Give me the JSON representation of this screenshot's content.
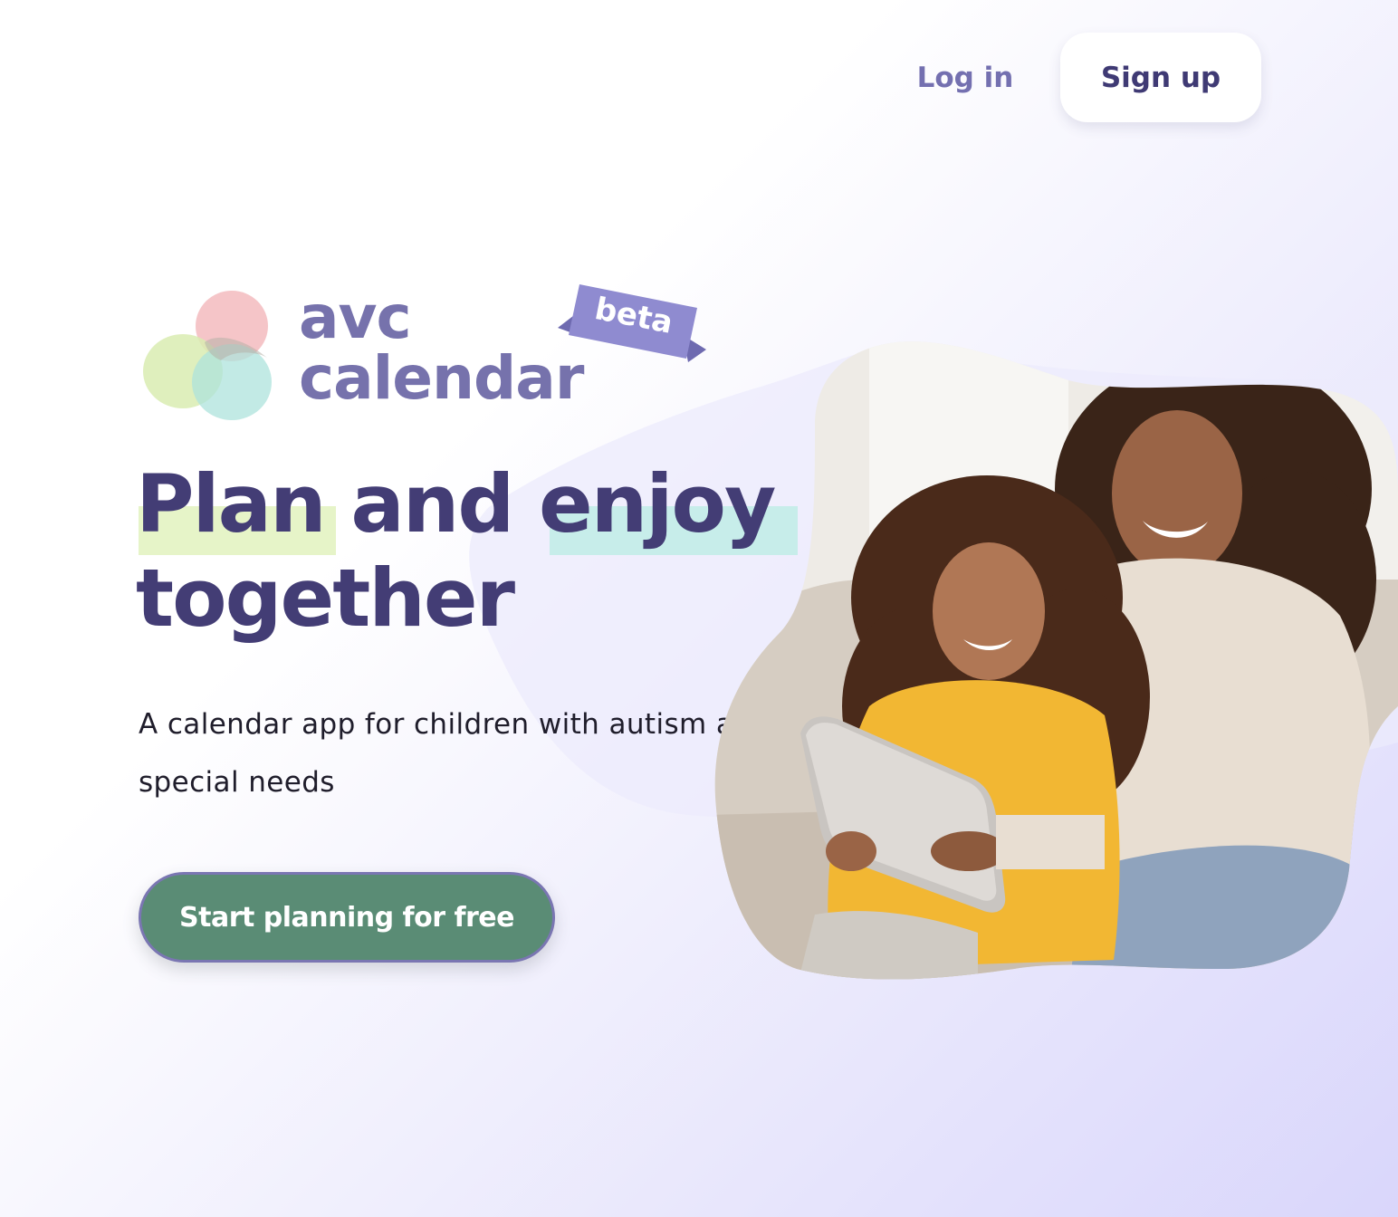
{
  "header": {
    "login_label": "Log in",
    "signup_label": "Sign up"
  },
  "logo": {
    "line1": "avc",
    "line2": "calendar",
    "badge": "beta"
  },
  "hero": {
    "headline_line1": "Plan and enjoy",
    "headline_line2": "together",
    "subtitle": "A calendar app for children with autism and special needs",
    "cta_label": "Start planning for free"
  },
  "colors": {
    "brand_purple": "#7672ac",
    "headline": "#433d75",
    "cta": "#5a8c75",
    "highlight_green": "#e6f4c8",
    "highlight_teal": "#c7edea",
    "badge": "#8f8bd0"
  },
  "icons": {
    "logo_mark": "three-overlapping-circles-icon",
    "hero_image": "mother-and-daughter-with-tablet-photo"
  }
}
